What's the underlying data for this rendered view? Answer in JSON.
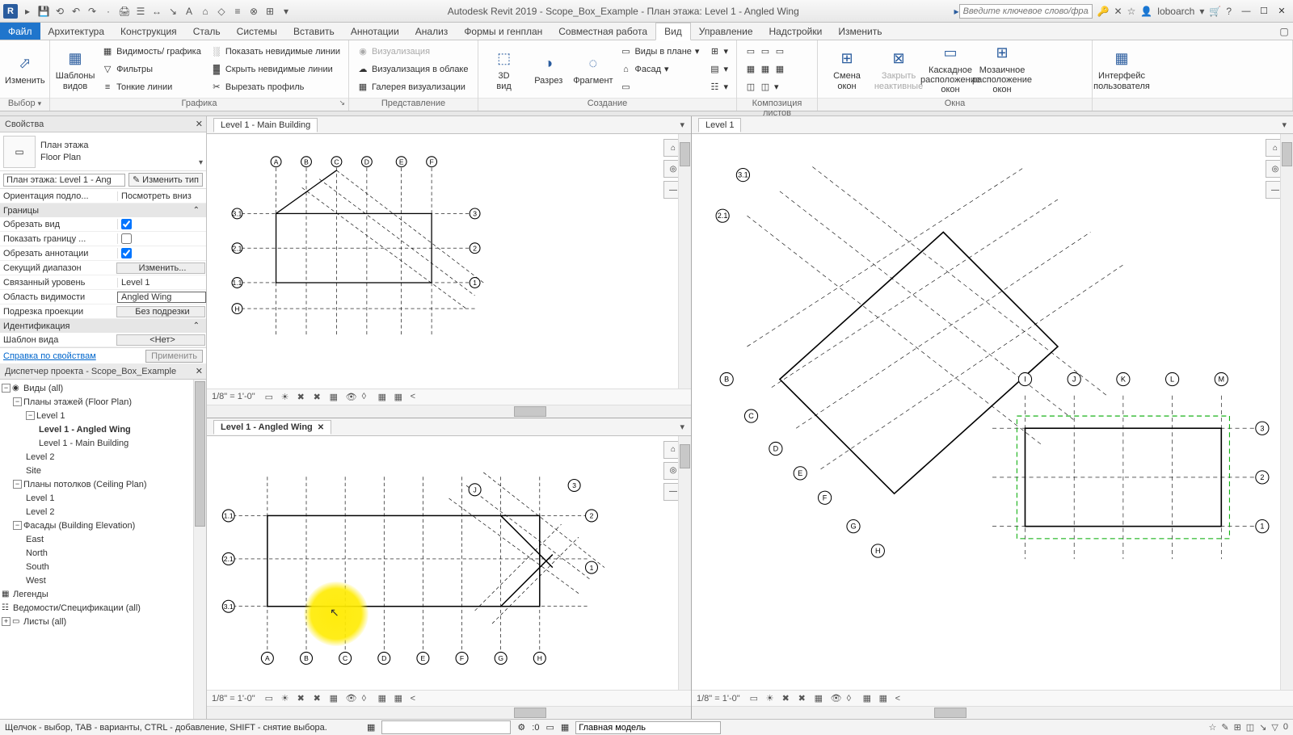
{
  "app": {
    "title": "Autodesk Revit 2019 - Scope_Box_Example - План этажа: Level 1 - Angled Wing",
    "search_placeholder": "Введите ключевое слово/фразу",
    "username": "loboarch"
  },
  "tabs": {
    "file": "Файл",
    "arch": "Архитектура",
    "struct": "Конструкция",
    "steel": "Сталь",
    "systems": "Системы",
    "insert": "Вставить",
    "annot": "Аннотации",
    "analyze": "Анализ",
    "mass": "Формы и генплан",
    "collab": "Совместная работа",
    "view": "Вид",
    "manage": "Управление",
    "addins": "Надстройки",
    "modify": "Изменить"
  },
  "ribbon": {
    "select_panel": "Выбор",
    "modify": "Изменить",
    "view_templates": "Шаблоны\nвидов",
    "visibility": "Видимость/ графика",
    "filters": "Фильтры",
    "thin_lines": "Тонкие линии",
    "show_hidden": "Показать невидимые линии",
    "remove_hidden": "Скрыть невидимые линии",
    "cut_profile": "Вырезать профиль",
    "graphics_panel": "Графика",
    "render": "Визуализация",
    "cloud_render": "Визуализация  в облаке",
    "render_gallery": "Галерея  визуализации",
    "presentation_panel": "Представление",
    "view3d": "3D\nвид",
    "section": "Разрез",
    "callout": "Фрагмент",
    "plan_views": "Виды в плане",
    "elevation": "Фасад",
    "create_panel": "Создание",
    "sheet_comp_panel": "Композиция листов",
    "switch_win": "Смена\nокон",
    "close_hidden": "Закрыть\nнеактивные",
    "cascade": "Каскадное\nрасположение окон",
    "tile": "Мозаичное\nрасположение окон",
    "windows_panel": "Окна",
    "ui": "Интерфейс\nпользователя"
  },
  "properties": {
    "title": "Свойства",
    "type_family": "План этажа",
    "type_name": "Floor Plan",
    "instance": "План этажа: Level 1 - Ang",
    "edit_type": "Изменить тип",
    "orient_lbl": "Ориентация подло...",
    "orient_val": "Посмотреть вниз",
    "group_extents": "Границы",
    "crop_view": "Обрезать вид",
    "crop_visible": "Показать границу ...",
    "annot_crop": "Обрезать аннотации",
    "view_range": "Секущий диапазон",
    "view_range_btn": "Изменить...",
    "assoc_level": "Связанный уровень",
    "assoc_level_val": "Level 1",
    "scope_box": "Область видимости",
    "scope_box_val": "Angled Wing",
    "depth_clip": "Подрезка проекции",
    "depth_clip_val": "Без подрезки",
    "group_identity": "Идентификация",
    "view_template": "Шаблон вида",
    "view_template_val": "<Нет>",
    "help_link": "Справка по свойствам",
    "apply": "Применить"
  },
  "browser": {
    "title": "Диспетчер проекта - Scope_Box_Example",
    "views_all": "Виды (all)",
    "floor_plans": "Планы этажей (Floor Plan)",
    "l1": "Level 1",
    "l1_angled": "Level 1 - Angled Wing",
    "l1_main": "Level 1 - Main Building",
    "l2": "Level 2",
    "site": "Site",
    "ceiling_plans": "Планы потолков (Ceiling Plan)",
    "cp_l1": "Level 1",
    "cp_l2": "Level 2",
    "elevations": "Фасады (Building Elevation)",
    "east": "East",
    "north": "North",
    "south": "South",
    "west": "West",
    "legends": "Легенды",
    "schedules": "Ведомости/Спецификации (all)",
    "sheets": "Листы (all)"
  },
  "views": {
    "v1_title": "Level 1 - Main Building",
    "v2_title": "Level 1 - Angled Wing",
    "v3_title": "Level 1",
    "scale": "1/8\" = 1'-0\""
  },
  "status": {
    "msg": "Щелчок - выбор, TAB - варианты, CTRL - добавление, SHIFT - снятие выбора.",
    "num": ":0",
    "workset": "Главная модель"
  }
}
